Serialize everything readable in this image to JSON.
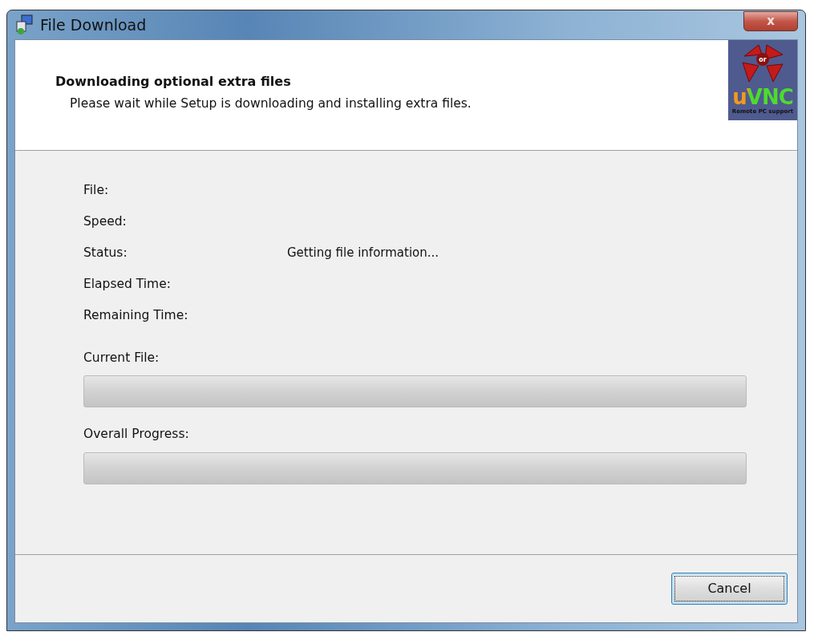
{
  "window": {
    "title": "File Download",
    "close_glyph": "x"
  },
  "header": {
    "title": "Downloading optional extra files",
    "subtitle": "Please wait while Setup is downloading and installing extra files.",
    "logo": {
      "badge": "or",
      "brand": "uVNC",
      "tagline": "Remote PC support"
    }
  },
  "fields": [
    {
      "label": "File:"
    },
    {
      "label": "Speed:"
    },
    {
      "label": "Status:",
      "value": "Getting file information..."
    },
    {
      "label": "Elapsed Time:"
    },
    {
      "label": "Remaining Time:"
    }
  ],
  "progress": [
    {
      "label": "Current File:",
      "level": 0
    },
    {
      "label": "Overall Progress:",
      "level": 0
    }
  ],
  "buttons": [
    {
      "label": "Cancel",
      "focused": true
    }
  ]
}
